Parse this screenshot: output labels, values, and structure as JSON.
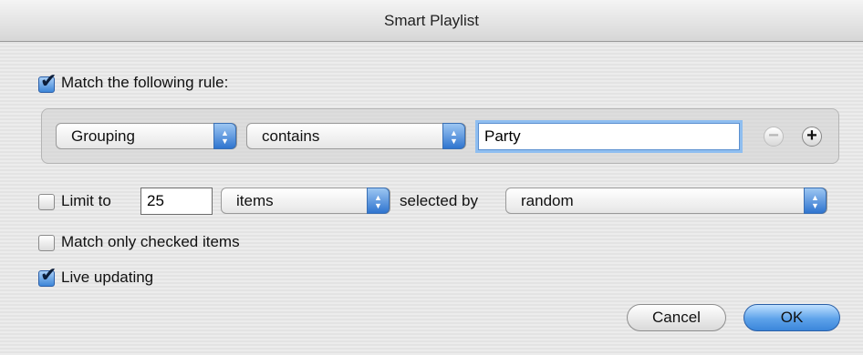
{
  "window": {
    "title": "Smart Playlist"
  },
  "match_rule": {
    "checked": true,
    "label": "Match the following rule:"
  },
  "rule": {
    "field": "Grouping",
    "operator": "contains",
    "value": "Party"
  },
  "limit": {
    "checked": false,
    "label": "Limit to",
    "amount": "25",
    "unit": "items",
    "selected_by_label": "selected by",
    "selected_by": "random"
  },
  "match_checked": {
    "checked": false,
    "label": "Match only checked items"
  },
  "live_updating": {
    "checked": true,
    "label": "Live updating"
  },
  "buttons": {
    "cancel": "Cancel",
    "ok": "OK"
  },
  "icons": {
    "remove_rule": "minus-circle-icon",
    "add_rule": "plus-circle-icon",
    "popup_arrows": "up-down-arrows-icon",
    "checkmark": "checkmark-icon"
  },
  "colors": {
    "accent": "#3b86da",
    "focus_ring": "#8fbef0"
  }
}
